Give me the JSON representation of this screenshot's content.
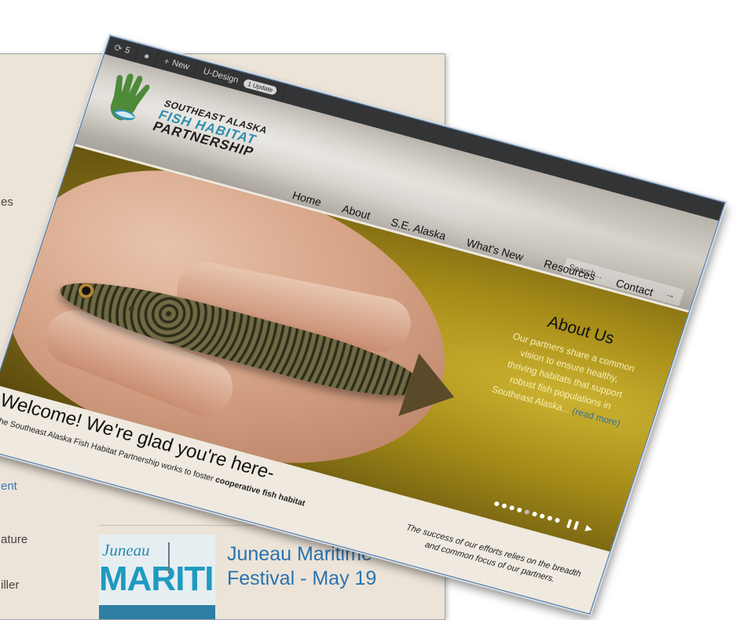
{
  "background_page": {
    "fragments": [
      "es",
      "ent",
      "ature",
      "iller"
    ],
    "event": {
      "thumb_top": "Juneau",
      "thumb_main": "MARITIME",
      "title": "Juneau Maritime Festival - May 19"
    }
  },
  "admin_bar": {
    "updates_count": "5",
    "new_label": "New",
    "theme_label": "U-Design",
    "update_badge": "1 Update"
  },
  "logo": {
    "line1": "SOUTHEAST ALASKA",
    "line2": "FISH HABITAT",
    "line3": "PARTNERSHIP"
  },
  "search": {
    "placeholder": "Search..."
  },
  "nav": {
    "items": [
      "Home",
      "About",
      "S.E. Alaska",
      "What's New",
      "Resources",
      "Contact"
    ]
  },
  "hero": {
    "about_title": "About Us",
    "about_text": "Our partners share a common vision to ensure healthy, thriving habitats that support robust fish populations in Southeast Alaska...",
    "read_more": "(read more)",
    "slide_count": 9,
    "active_slide": 4
  },
  "welcome": {
    "title": "Welcome! We're glad you're here-",
    "text_start": "The Southeast Alaska Fish Habitat Partnership works to foster",
    "text_bold": "cooperative fish habitat",
    "success_text": "The success of our efforts relies on the breadth and common focus of our partners."
  },
  "colors": {
    "admin_bar": "#333436",
    "accent_teal": "#2f8fb0",
    "link_blue": "#3b76b5",
    "about_text": "#f7efb6"
  }
}
